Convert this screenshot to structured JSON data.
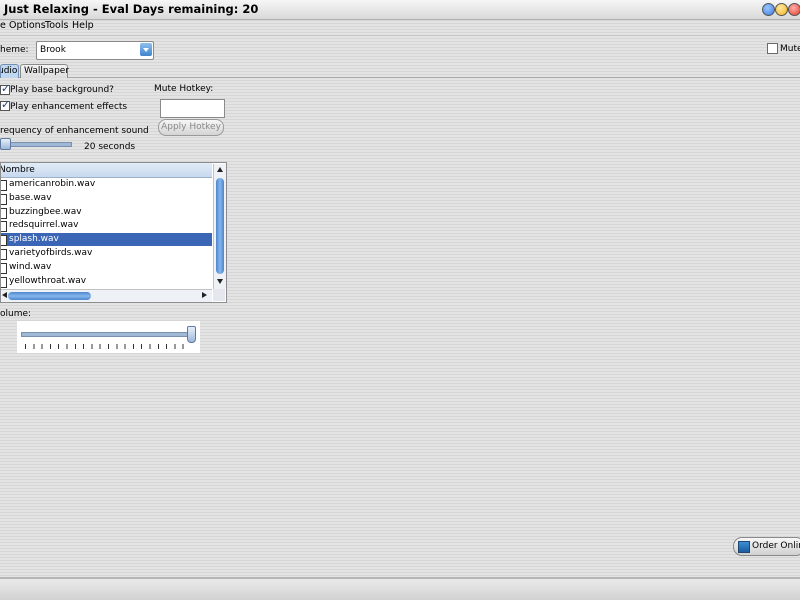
{
  "window": {
    "title": "Just Relaxing - Eval Days remaining: 20",
    "controls": [
      "minimize-icon",
      "maximize-icon",
      "close-icon"
    ],
    "control_colors": {
      "minimize": "#3a7de0",
      "maximize": "#f2b51c",
      "close": "#e23b2e"
    }
  },
  "menu": {
    "items": [
      {
        "label": "e"
      },
      {
        "label": "Options"
      },
      {
        "label": "Tools"
      },
      {
        "label": "Help"
      }
    ]
  },
  "theme": {
    "label": "heme:",
    "value": "Brook"
  },
  "mute": {
    "label": "Mute",
    "checked": false
  },
  "tabs": [
    {
      "label": "udio",
      "active": true
    },
    {
      "label": "Wallpaper",
      "active": false
    }
  ],
  "audio": {
    "play_base": {
      "label": "Play base background?",
      "checked": true
    },
    "play_effects": {
      "label": "Play enhancement effects",
      "checked": true
    },
    "hotkey": {
      "label": "Mute Hotkey:",
      "value": "",
      "apply_label": "Apply Hotkey"
    },
    "frequency": {
      "label": "requency of enhancement sound",
      "value_text": "20 seconds",
      "level": 0.0
    },
    "sound_list": {
      "header": "Nombre",
      "files": [
        "americanrobin.wav",
        "base.wav",
        "buzzingbee.wav",
        "redsquirrel.wav",
        "splash.wav",
        "varietyofbirds.wav",
        "wind.wav",
        "yellowthroat.wav"
      ],
      "selected_index": 4
    },
    "volume": {
      "label": "olume:",
      "level": 1.0
    }
  },
  "order": {
    "label": "Order Online",
    "icon": "globe-icon"
  },
  "colors": {
    "selection": "#3b66b5",
    "scroll_thumb": "#4c86cf"
  }
}
